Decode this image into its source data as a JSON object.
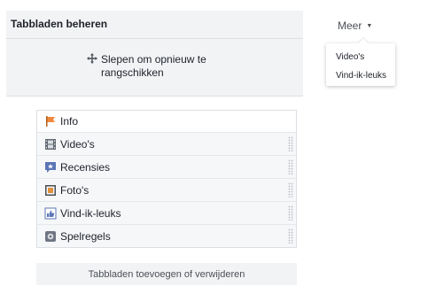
{
  "panel": {
    "title": "Tabbladen beheren",
    "drag_hint": "Slepen om opnieuw te rangschikken"
  },
  "tabs": [
    {
      "label": "Info",
      "icon": "flag-icon",
      "color": "#f0883e"
    },
    {
      "label": "Video's",
      "icon": "film-icon",
      "color": "#8d949e"
    },
    {
      "label": "Recensies",
      "icon": "review-icon",
      "color": "#5b76b5"
    },
    {
      "label": "Foto's",
      "icon": "photo-icon",
      "color": "#e0913c"
    },
    {
      "label": "Vind-ik-leuks",
      "icon": "like-icon",
      "color": "#5b76b5"
    },
    {
      "label": "Spelregels",
      "icon": "rules-icon",
      "color": "#6f7683"
    }
  ],
  "footer": {
    "add_remove_label": "Tabbladen toevoegen of verwijderen"
  },
  "more": {
    "label": "Meer",
    "menu_items": [
      "Video's",
      "Vind-ik-leuks"
    ]
  }
}
